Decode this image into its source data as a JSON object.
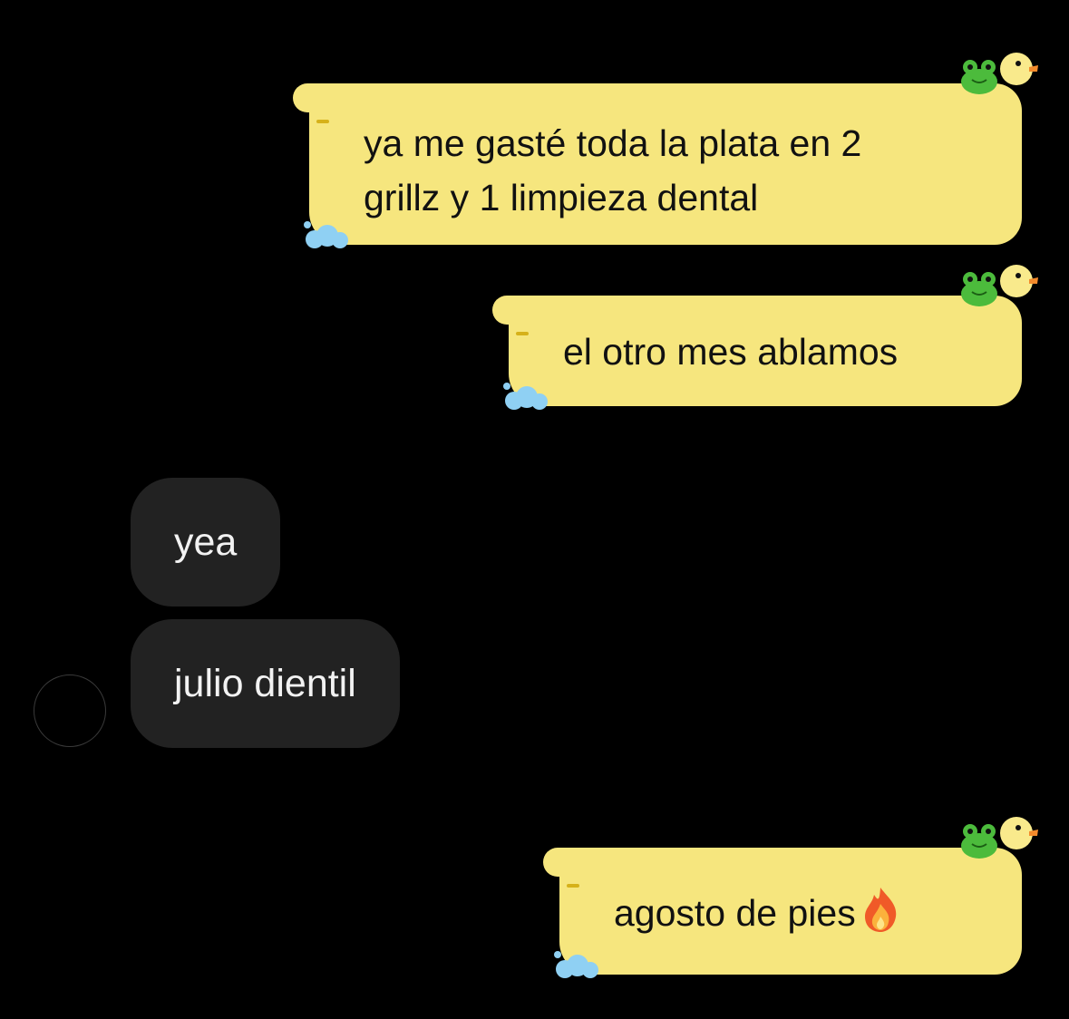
{
  "messages": [
    {
      "direction": "sent",
      "text": "ya me gasté toda la plata en 2\ngrillz y 1 limpieza dental"
    },
    {
      "direction": "sent",
      "text": "el otro mes ablamos"
    },
    {
      "direction": "received",
      "text": "yea"
    },
    {
      "direction": "received",
      "text": "julio dientil"
    },
    {
      "direction": "sent",
      "text": "agosto de pies",
      "emoji": "fire-icon"
    }
  ],
  "theme": {
    "sent_bubble_color": "#f6e67e",
    "received_bubble_color": "#222222",
    "background": "#000000",
    "decorations": [
      "duck-icon",
      "frog-icon",
      "cloud-icon"
    ]
  }
}
